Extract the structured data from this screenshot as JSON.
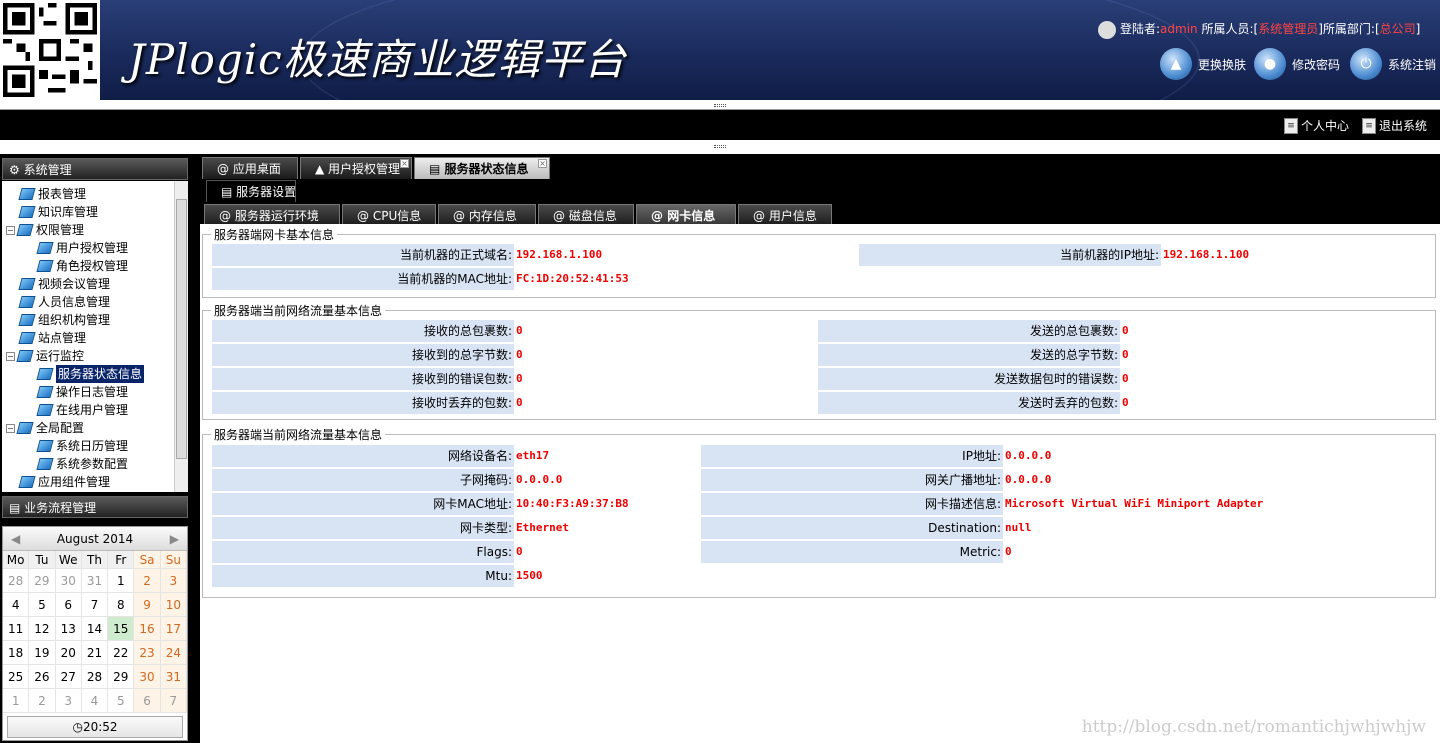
{
  "header": {
    "title": "JPlogic极速商业逻辑平台",
    "user_prefix": "登陆者:",
    "user_name": "admin",
    "role_prefix": "所属人员:[",
    "role": "系统管理员",
    "dept_prefix": "]所属部门:[",
    "dept": "总公司",
    "dept_suffix": "]",
    "buttons": [
      {
        "label": "更换换肤",
        "icon": "shirt-icon"
      },
      {
        "label": "修改密码",
        "icon": "lock-icon"
      },
      {
        "label": "系统注销",
        "icon": "power-icon"
      }
    ]
  },
  "toplinks": [
    {
      "label": "个人中心",
      "icon": "page-icon"
    },
    {
      "label": "退出系统",
      "icon": "page-icon"
    }
  ],
  "left": {
    "panel_title": "系统管理",
    "tree": [
      {
        "label": "报表管理"
      },
      {
        "label": "知识库管理"
      },
      {
        "label": "权限管理"
      },
      {
        "label": "用户授权管理"
      },
      {
        "label": "角色授权管理"
      },
      {
        "label": "视频会议管理"
      },
      {
        "label": "人员信息管理"
      },
      {
        "label": "组织机构管理"
      },
      {
        "label": "站点管理"
      },
      {
        "label": "运行监控"
      },
      {
        "label": "服务器状态信息"
      },
      {
        "label": "操作日志管理"
      },
      {
        "label": "在线用户管理"
      },
      {
        "label": "全局配置"
      },
      {
        "label": "系统日历管理"
      },
      {
        "label": "系统参数配置"
      },
      {
        "label": "应用组件管理"
      }
    ],
    "panel2_title": "业务流程管理"
  },
  "calendar": {
    "month": "August 2014",
    "prev": "◀",
    "next": "▶",
    "weekdays": [
      "Mo",
      "Tu",
      "We",
      "Th",
      "Fr",
      "Sa",
      "Su"
    ],
    "days": [
      "28",
      "29",
      "30",
      "31",
      "1",
      "2",
      "3",
      "4",
      "5",
      "6",
      "7",
      "8",
      "9",
      "10",
      "11",
      "12",
      "13",
      "14",
      "15",
      "16",
      "17",
      "18",
      "19",
      "20",
      "21",
      "22",
      "23",
      "24",
      "25",
      "26",
      "27",
      "28",
      "29",
      "30",
      "31",
      "1",
      "2",
      "3",
      "4",
      "5",
      "6",
      "7"
    ],
    "time": "20:52"
  },
  "tabs": [
    {
      "label": "应用桌面"
    },
    {
      "label": "用户授权管理"
    },
    {
      "label": "服务器状态信息"
    }
  ],
  "subtoolbar": "服务器设置",
  "subtabs": [
    {
      "label": "服务器运行环境"
    },
    {
      "label": "CPU信息"
    },
    {
      "label": "内存信息"
    },
    {
      "label": "磁盘信息"
    },
    {
      "label": "网卡信息"
    },
    {
      "label": "用户信息"
    }
  ],
  "sections": {
    "basic": {
      "legend": "服务器端网卡基本信息",
      "domain_label": "当前机器的正式域名:",
      "domain_value": "192.168.1.100",
      "ip_label": "当前机器的IP地址:",
      "ip_value": "192.168.1.100",
      "mac_label": "当前机器的MAC地址:",
      "mac_value": "FC:1D:20:52:41:53"
    },
    "traffic": {
      "legend": "服务器端当前网络流量基本信息",
      "rows": [
        {
          "l1": "接收的总包裹数:",
          "v1": "0",
          "l2": "发送的总包裹数:",
          "v2": "0"
        },
        {
          "l1": "接收到的总字节数:",
          "v1": "0",
          "l2": "发送的总字节数:",
          "v2": "0"
        },
        {
          "l1": "接收到的错误包数:",
          "v1": "0",
          "l2": "发送数据包时的错误数:",
          "v2": "0"
        },
        {
          "l1": "接收时丢弃的包数:",
          "v1": "0",
          "l2": "发送时丢弃的包数:",
          "v2": "0"
        }
      ]
    },
    "device": {
      "legend": "服务器端当前网络流量基本信息",
      "rows": [
        {
          "l1": "网络设备名:",
          "v1": "eth17",
          "l2": "IP地址:",
          "v2": "0.0.0.0"
        },
        {
          "l1": "子网掩码:",
          "v1": "0.0.0.0",
          "l2": "网关广播地址:",
          "v2": "0.0.0.0"
        },
        {
          "l1": "网卡MAC地址:",
          "v1": "10:40:F3:A9:37:B8",
          "l2": "网卡描述信息:",
          "v2": "Microsoft Virtual WiFi Miniport Adapter"
        },
        {
          "l1": "网卡类型:",
          "v1": "Ethernet",
          "l2": "Destination:",
          "v2": "null"
        },
        {
          "l1": "Flags:",
          "v1": "0",
          "l2": "Metric:",
          "v2": "0"
        },
        {
          "l1": "Mtu:",
          "v1": "1500"
        }
      ]
    }
  },
  "watermark": "http://blog.csdn.net/romantichjwhjwhjw"
}
